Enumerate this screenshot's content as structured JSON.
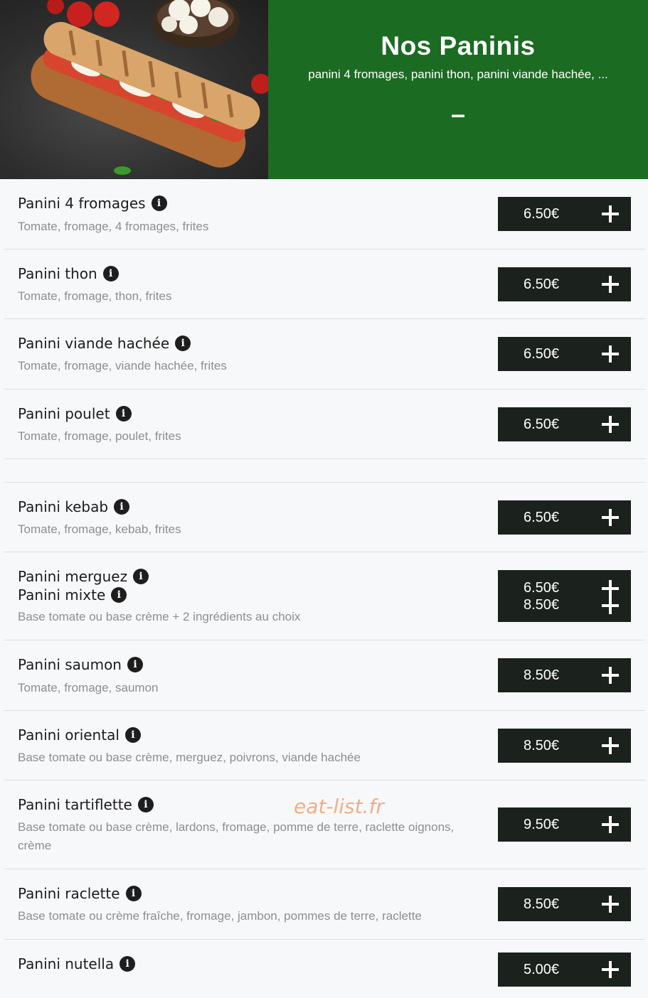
{
  "header": {
    "title": "Nos Paninis",
    "subtitle": "panini 4 fromages, panini thon, panini viande hachée, ...",
    "toggle": "–",
    "hero_image": "panini-with-tomato-mozzarella-basil"
  },
  "colors": {
    "banner": "#1b6b22",
    "button": "#1b211c",
    "page_bg": "#f7f8fa",
    "desc_text": "#8e8e8e",
    "watermark": "#f0a878"
  },
  "items": [
    {
      "name": "Panini 4 fromages",
      "desc": "Tomate, fromage, 4 fromages, frites",
      "price": "6.50€"
    },
    {
      "name": "Panini thon",
      "desc": "Tomate, fromage, thon, frites",
      "price": "6.50€"
    },
    {
      "name": "Panini viande hachée",
      "desc": "Tomate, fromage, viande hachée, frites",
      "price": "6.50€"
    },
    {
      "name": "Panini poulet",
      "desc": "Tomate, fromage, poulet, frites",
      "price": "6.50€"
    },
    {
      "name": "Panini kebab",
      "desc": "Tomate, fromage, kebab, frites",
      "price": "6.50€"
    },
    {
      "name": "Panini merguez",
      "price": "6.50€"
    },
    {
      "name": "Panini mixte",
      "desc": "Base tomate ou base crème + 2 ingrédients au choix",
      "price": "8.50€"
    },
    {
      "name": "Panini saumon",
      "desc": "Tomate, fromage, saumon",
      "price": "8.50€"
    },
    {
      "name": "Panini oriental",
      "desc": "Base tomate ou base crème, merguez, poivrons, viande hachée",
      "price": "8.50€"
    },
    {
      "name": "Panini tartiflette",
      "desc": "Base tomate ou base crème, lardons, fromage, pomme de terre, raclette oignons, crème",
      "price": "9.50€"
    },
    {
      "name": "Panini raclette",
      "desc": "Base tomate ou crème fraîche, fromage, jambon, pommes de terre, raclette",
      "price": "8.50€"
    },
    {
      "name": "Panini nutella",
      "price": "5.00€"
    }
  ],
  "info_glyph": "i",
  "watermark": "eat-list.fr"
}
